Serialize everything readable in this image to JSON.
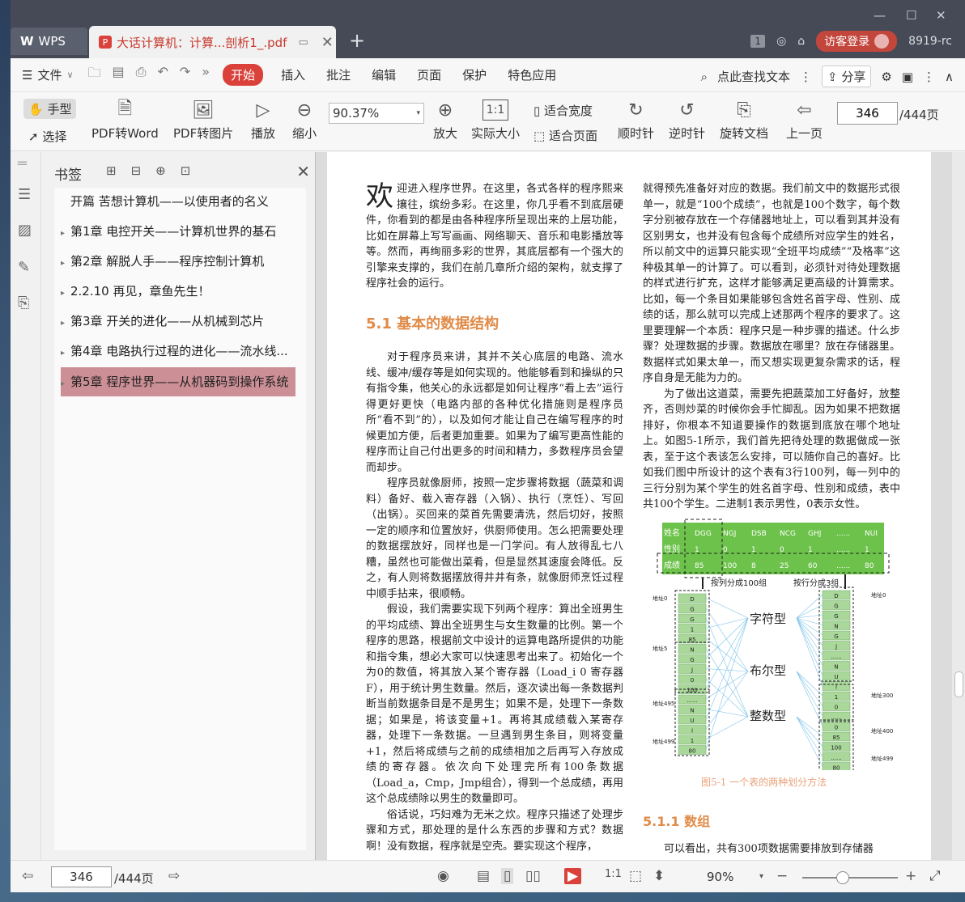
{
  "titlebar": {
    "wps_tab": "WPS",
    "doc_tab": "大话计算机：计算...剖析1_.pdf",
    "page_count_badge": "1",
    "login": "访客登录",
    "version": "8919-rc"
  },
  "menu": {
    "file": "文件",
    "tabs": [
      "开始",
      "插入",
      "批注",
      "编辑",
      "页面",
      "保护",
      "特色应用"
    ],
    "search": "点此查找文本",
    "share": "分享"
  },
  "ribbon": {
    "hand": "手型",
    "select": "选择",
    "pdf_to_word": "PDF转Word",
    "pdf_to_image": "PDF转图片",
    "play": "播放",
    "zoom_out": "缩小",
    "zoom_value": "90.37%",
    "zoom_in": "放大",
    "actual_size": "实际大小",
    "fit_width": "适合宽度",
    "fit_page": "适合页面",
    "rotate_cw": "顺时针",
    "rotate_ccw": "逆时针",
    "rotate_doc": "旋转文档",
    "prev_page": "上一页",
    "page_current": "346",
    "page_total": "/444页"
  },
  "bookmarks": {
    "title": "书签",
    "items": [
      {
        "label": "开篇  苦想计算机——以使用者的名义",
        "expandable": false
      },
      {
        "label": "第1章  电控开关——计算机世界的基石",
        "expandable": true
      },
      {
        "label": "第2章  解脱人手——程序控制计算机",
        "expandable": true
      },
      {
        "label": "2.2.10  再见，章鱼先生！",
        "expandable": true
      },
      {
        "label": "第3章  开关的进化——从机械到芯片",
        "expandable": true
      },
      {
        "label": "第4章  电路执行过程的进化——流水线...",
        "expandable": true
      },
      {
        "label": "第5章  程序世界——从机器码到操作系统",
        "expandable": true
      }
    ]
  },
  "page": {
    "dropcap": "欢",
    "intro_rest": "迎进入程序世界。在这里，各式各样的程序熙来攘往，缤纷多彩。在这里，你几乎看不到底层硬件，你看到的都是由各种程序所呈现出来的上层功能，比如在屏幕上写写画画、网络聊天、音乐和电影播放等等。然而，再绚丽多彩的世界，其底层都有一个强大的引擎来支撑的，我们在前几章所介绍的架构，就支撑了程序社会的运行。",
    "h51": "5.1   基本的数据结构",
    "left_paras": [
      "对于程序员来讲，其并不关心底层的电路、流水线、缓冲/缓存等是如何实现的。他能够看到和操纵的只有指令集，他关心的永远都是如何让程序“看上去”运行得更好更快（电路内部的各种优化措施则是程序员所“看不到”的），以及如何才能让自己在编写程序的时候更加方便，后者更加重要。如果为了编写更高性能的程序而让自己付出更多的时间和精力，多数程序员会望而却步。",
      "程序员就像厨师，按照一定步骤将数据（蔬菜和调料）备好、载入寄存器（入锅）、执行（烹饪）、写回（出锅）。买回来的菜首先需要清洗，然后切好，按照一定的顺序和位置放好，供厨师使用。怎么把需要处理的数据摆放好，同样也是一门学问。有人放得乱七八糟，虽然也可能做出菜肴，但是显然其速度会降低。反之，有人则将数据摆放得井井有条，就像厨师烹饪过程中顺手拈来，很顺畅。",
      "假设，我们需要实现下列两个程序：算出全班男生的平均成绩、算出全班男生与女生数量的比例。第一个程序的思路，根据前文中设计的运算电路所提供的功能和指令集，想必大家可以快速思考出来了。初始化一个为0的数值，将其放入某个寄存器（Load_i 0 寄存器F），用于统计男生数量。然后，逐次读出每一条数据判断当前数据条目是不是男生；如果不是，处理下一条数据；如果是，将该变量+1。再将其成绩载入某寄存器，处理下一条数据。一旦遇到男生条目，则将变量+1，然后将成绩与之前的成绩相加之后再写入存放成绩的寄存器。依次向下处理完所有100条数据（Load_a，Cmp，Jmp组合），得到一个总成绩，再用这个总成绩除以男生的数量即可。",
      "俗话说，巧妇难为无米之炊。程序只描述了处理步骤和方式，那处理的是什么东西的步骤和方式？数据啊！没有数据，程序就是空壳。要实现这个程序，"
    ],
    "right_paras": [
      "就得预先准备好对应的数据。我们前文中的数据形式很单一，就是“100个成绩”，也就是100个数字，每个数字分别被存放在一个存储器地址上，可以看到其并没有区别男女，也并没有包含每个成绩所对应学生的姓名，所以前文中的运算只能实现“全班平均成绩”“及格率”这种极其单一的计算了。可以看到，必须针对待处理数据的样式进行扩充，这样才能够满足更高级的计算需求。比如，每一个条目如果能够包含姓名首字母、性别、成绩的话，那么就可以完成上述那两个程序的要求了。这里要理解一个本质：程序只是一种步骤的描述。什么步骤？处理数据的步骤。数据放在哪里？放在存储器里。数据样式如果太单一，而又想实现更复杂需求的话，程序自身是无能为力的。",
      "为了做出这道菜，需要先把蔬菜加工好备好，放整齐，否则炒菜的时候你会手忙脚乱。因为如果不把数据排好，你根本不知道要操作的数据到底放在哪个地址上。如图5-1所示，我们首先把待处理的数据做成一张表，至于这个表该怎么安排，可以随你自己的喜好。比如我们图中所设计的这个表有3行100列，每一列中的三行分别为某个学生的姓名首字母、性别和成绩，表中共100个学生。二进制1表示男性，0表示女性。"
    ],
    "figure_caption": "图5-1   一个表的两种划分方法",
    "h511": "5.1.1   数组",
    "last_line": "可以看出，共有300项数据需要排放到存储器"
  },
  "figure": {
    "row_labels": [
      "姓名",
      "性别",
      "成绩"
    ],
    "columns": [
      "DGG",
      "NGJ",
      "DSB",
      "NCG",
      "GHJ",
      "......",
      "NUI"
    ],
    "gender": [
      "1",
      "0",
      "1",
      "0",
      "1",
      "......",
      "1"
    ],
    "scores": [
      "85",
      "100",
      "8",
      "25",
      "60",
      "......",
      "80"
    ],
    "split_col": "按列分成100组",
    "split_row": "按行分成3组",
    "type_char": "字符型",
    "type_bool": "布尔型",
    "type_int": "整数型",
    "left_stack": [
      "D",
      "G",
      "G",
      "1",
      "85",
      "N",
      "G",
      "J",
      "0",
      "100",
      "......",
      "N",
      "U",
      "I",
      "1",
      "80"
    ],
    "right_stack": [
      "D",
      "G",
      "G",
      "N",
      "G",
      "J",
      "......",
      "N",
      "U",
      "I",
      "1",
      "0",
      "......",
      "0",
      "85",
      "100",
      "......",
      "80"
    ],
    "left_addr": [
      "地址0",
      "地址5",
      "地址495",
      "地址499"
    ],
    "right_addr": [
      "地址0",
      "地址300",
      "地址400",
      "地址499"
    ]
  },
  "statusbar": {
    "page_current": "346",
    "page_total": "/444页",
    "zoom": "90%"
  }
}
